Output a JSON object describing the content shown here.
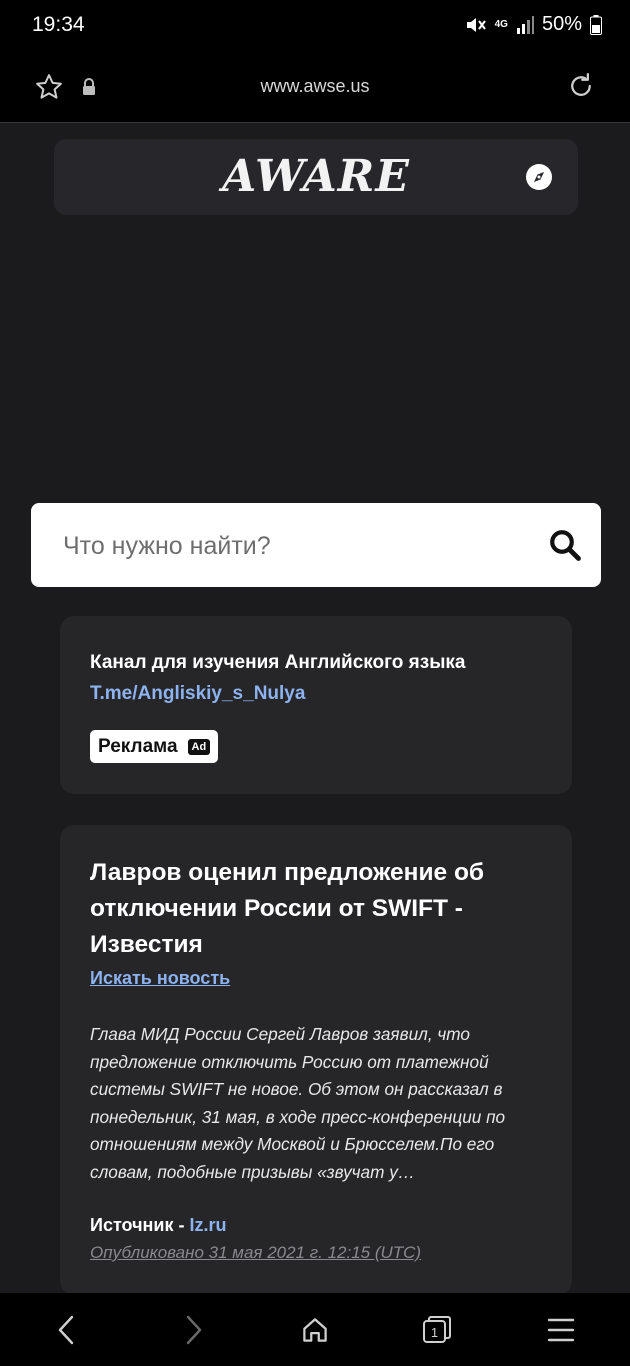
{
  "status": {
    "time": "19:34",
    "network": "4G",
    "battery": "50%"
  },
  "browser": {
    "url": "www.awse.us"
  },
  "site": {
    "logo": "AWARE"
  },
  "search": {
    "placeholder": "Что нужно найти?"
  },
  "ad": {
    "title": "Канал для изучения Английского языка",
    "link": "T.me/Angliskiy_s_Nulya",
    "badge_label": "Реклама",
    "badge_tag": "Ad"
  },
  "news": {
    "title": "Лавров оценил предложение об отключении России от SWIFT - Известия",
    "search_link": "Искать новость",
    "body": "Глава МИД России Сергей Лавров заявил, что предложение отключить Россию от платежной системы SWIFT не новое. Об этом он рассказал в понедельник, 31 мая, в ходе пресс-конференции по отношениям между Москвой и Брюсселем.По его словам, подобные призывы «звучат у…",
    "source_label": "Источник -",
    "source_name": "Iz.ru",
    "published": "Опубликовано 31 мая 2021 г. 12:15 (UTC)"
  },
  "navbar": {
    "tabs_count": "1"
  },
  "colors": {
    "background": "#1b1b1d",
    "card": "#262629",
    "link": "#8cb2ef"
  }
}
